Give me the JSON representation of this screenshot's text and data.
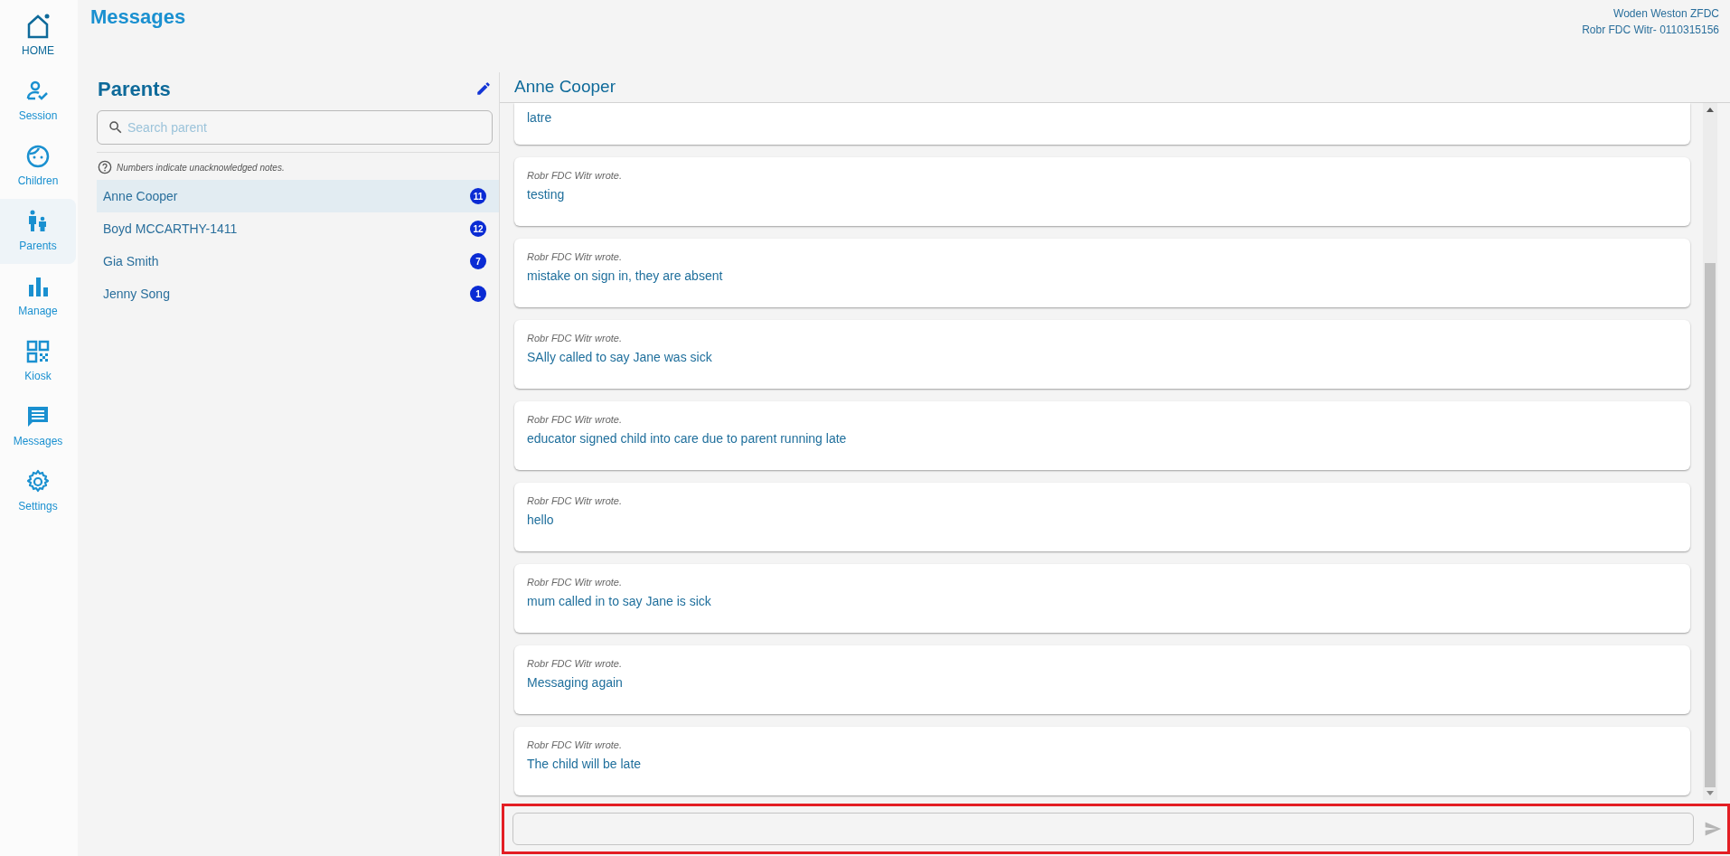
{
  "nav": [
    {
      "label": "HOME",
      "selected": false
    },
    {
      "label": "Session",
      "selected": false
    },
    {
      "label": "Children",
      "selected": false
    },
    {
      "label": "Parents",
      "selected": true
    },
    {
      "label": "Manage",
      "selected": false
    },
    {
      "label": "Kiosk",
      "selected": false
    },
    {
      "label": "Messages",
      "selected": false
    },
    {
      "label": "Settings",
      "selected": false
    }
  ],
  "page_title": "Messages",
  "account": {
    "service": "Woden Weston ZFDC",
    "user": "Robr FDC Witr- 0110315156"
  },
  "parents_panel": {
    "title": "Parents",
    "search": {
      "placeholder": "Search parent"
    },
    "hint": "Numbers indicate unacknowledged notes.",
    "items": [
      {
        "name": "Anne Cooper",
        "count": "11",
        "selected": true
      },
      {
        "name": "Boyd MCCARTHY-1411",
        "count": "12",
        "selected": false
      },
      {
        "name": "Gia Smith",
        "count": "7",
        "selected": false
      },
      {
        "name": "Jenny Song",
        "count": "1",
        "selected": false
      }
    ]
  },
  "conversation": {
    "title": "Anne Cooper",
    "messages": [
      {
        "text": "latre"
      },
      {
        "author": "Robr FDC Witr wrote.",
        "text": "testing"
      },
      {
        "author": "Robr FDC Witr wrote.",
        "text": "mistake on sign in, they are absent"
      },
      {
        "author": "Robr FDC Witr wrote.",
        "text": "SAlly called to say Jane was sick"
      },
      {
        "author": "Robr FDC Witr wrote.",
        "text": "educator signed child into care due to parent running late"
      },
      {
        "author": "Robr FDC Witr wrote.",
        "text": "hello"
      },
      {
        "author": "Robr FDC Witr wrote.",
        "text": "mum called in to say Jane is sick"
      },
      {
        "author": "Robr FDC Witr wrote.",
        "text": "Messaging again"
      },
      {
        "author": "Robr FDC Witr wrote.",
        "text": "The child will be late"
      }
    ],
    "compose": {
      "highlighted": true
    }
  }
}
